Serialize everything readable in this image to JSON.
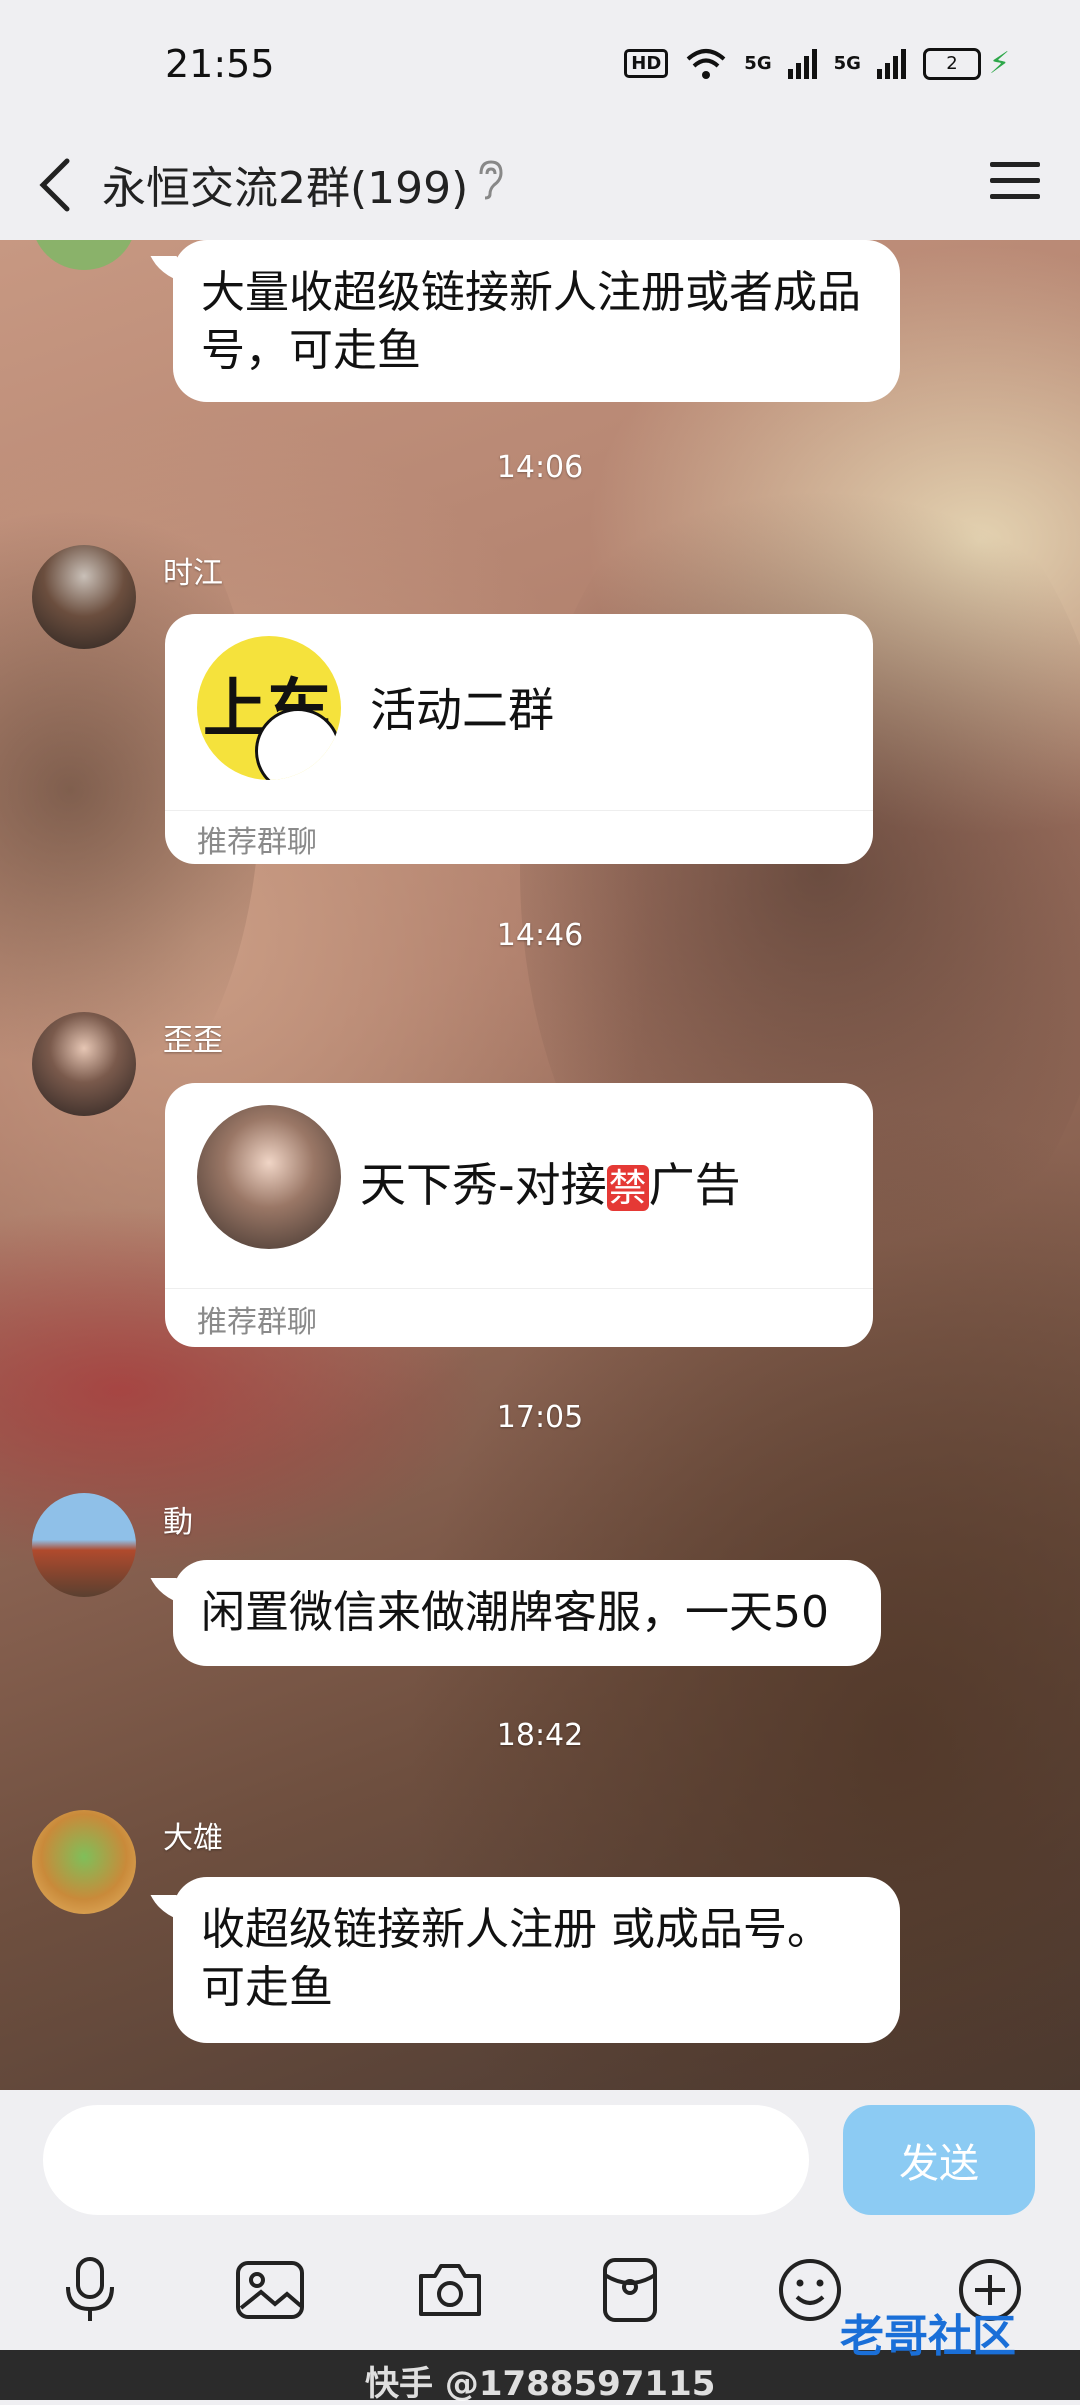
{
  "status_bar": {
    "time": "21:55",
    "hd": "HD",
    "net1": "5G",
    "net2": "5G",
    "battery": "2"
  },
  "header": {
    "title": "永恒交流2群(199)"
  },
  "messages": [
    {
      "text": "大量收超级链接新人注册或者成品号，可走鱼"
    },
    {
      "timestamp": "14:06"
    },
    {
      "sender": "时江",
      "card_title": "活动二群",
      "card_footer": "推荐群聊",
      "thumb_text": "上车"
    },
    {
      "timestamp": "14:46"
    },
    {
      "sender": "歪歪",
      "card_title_prefix": "天下秀-对接",
      "card_badge": "禁",
      "card_title_suffix": "广告",
      "card_footer": "推荐群聊"
    },
    {
      "timestamp": "17:05"
    },
    {
      "sender": "動",
      "text": "闲置微信来做潮牌客服，一天50"
    },
    {
      "timestamp": "18:42"
    },
    {
      "sender": "大雄",
      "text": "收超级链接新人注册 或成品号。可走鱼"
    }
  ],
  "input": {
    "placeholder": "",
    "send_label": "发送",
    "send_color": "#8ccbf3"
  },
  "toolbar": [
    "mic-icon",
    "image-icon",
    "camera-icon",
    "red-packet-icon",
    "emoji-icon",
    "plus-icon"
  ],
  "watermark": {
    "text": "快手 @1788597115",
    "logo": "老哥社区"
  }
}
